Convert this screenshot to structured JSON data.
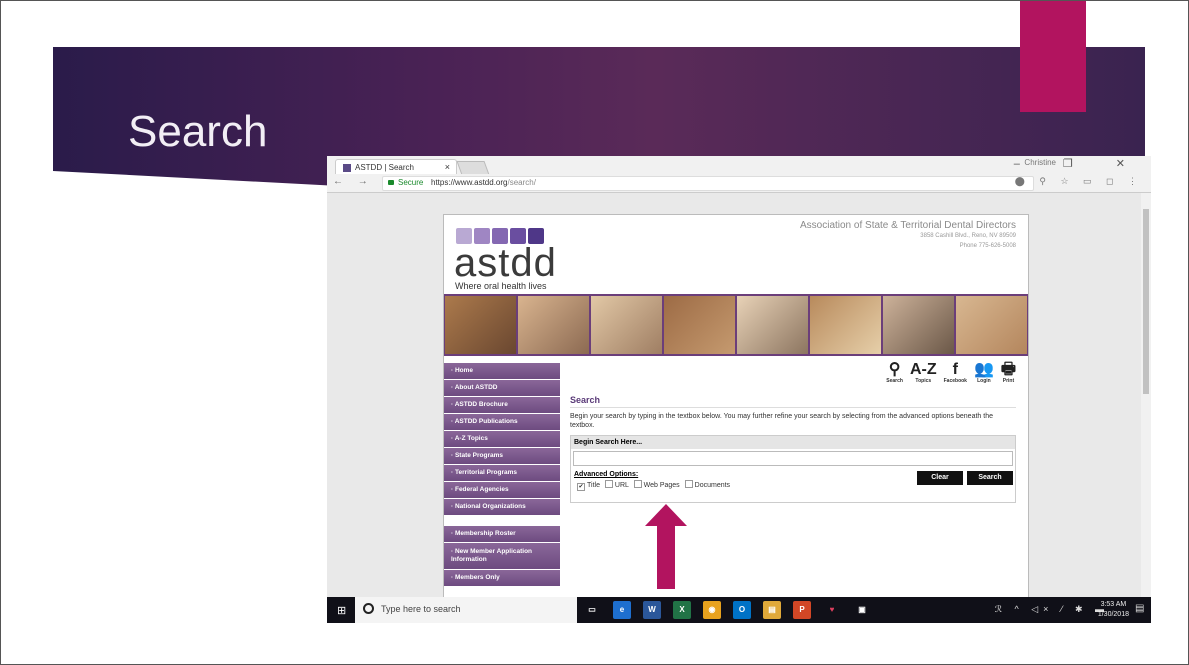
{
  "slide": {
    "title": "Search",
    "accent_color": "#b2145f"
  },
  "browser": {
    "tab_title": "ASTDD | Search",
    "tab_close": "×",
    "user_name": "Christine",
    "window_controls": "– ❐ ✕",
    "nav_buttons": "← → C",
    "secure_label": "Secure",
    "url_host": "https://www.astdd.org",
    "url_path": "/search/",
    "ext_icons": "⬤ ⚲ ☆ ▭ ◻ ⋮"
  },
  "site": {
    "org_name": "Association of State & Territorial Dental Directors",
    "org_address": "3858 Cashill Blvd., Reno, NV 89509",
    "org_phone": "Phone 775-626-5008",
    "logo_text": "astdd",
    "logo_tagline": "Where oral health lives",
    "logo_colors": [
      "#b9a9d3",
      "#9f86c3",
      "#8468b2",
      "#6a4ea0",
      "#4f3788"
    ],
    "nav_items": [
      "· Home",
      "· About ASTDD",
      "· ASTDD Brochure",
      "· ASTDD Publications",
      "· A-Z Topics",
      "· State Programs",
      "· Territorial Programs",
      "· Federal Agencies",
      "· National Organizations"
    ],
    "nav_items_2": [
      "· Membership Roster",
      "· New Member Application Information",
      "· Members Only"
    ],
    "icons": [
      {
        "glyph": "⚲",
        "label": "Search",
        "icon": "search-icon"
      },
      {
        "glyph": "A-Z",
        "label": "Topics",
        "icon": "az-topics-icon"
      },
      {
        "glyph": "f",
        "label": "Facebook",
        "icon": "facebook-icon"
      },
      {
        "glyph": "👥",
        "label": "Login",
        "icon": "login-icon"
      },
      {
        "glyph": "🖶",
        "label": "Print",
        "icon": "print-icon"
      }
    ]
  },
  "search": {
    "title": "Search",
    "description": "Begin your search by typing in the textbox below. You may further refine your search by selecting from the advanced options beneath the textbox.",
    "box_header": "Begin Search Here...",
    "input_value": "",
    "advanced_label": "Advanced Options:",
    "options": [
      {
        "label": "Title",
        "checked": true
      },
      {
        "label": "URL",
        "checked": false
      },
      {
        "label": "Web Pages",
        "checked": false
      },
      {
        "label": "Documents",
        "checked": false
      }
    ],
    "clear_label": "Clear",
    "search_label": "Search"
  },
  "taskbar": {
    "search_placeholder": "Type here to search",
    "time": "3:53 AM",
    "date": "1/30/2018",
    "tray_icons": "ℛ ^ ◁× ⁄ ✱ ▬",
    "apps": [
      {
        "label": "▭",
        "color": "#101018",
        "icon": "task-view-icon"
      },
      {
        "label": "e",
        "color": "#1e6fcf",
        "icon": "edge-icon"
      },
      {
        "label": "W",
        "color": "#2b579a",
        "icon": "word-icon"
      },
      {
        "label": "X",
        "color": "#217346",
        "icon": "excel-icon"
      },
      {
        "label": "◉",
        "color": "#e8a21e",
        "icon": "chrome-icon"
      },
      {
        "label": "O",
        "color": "#0072c6",
        "icon": "outlook-icon"
      },
      {
        "label": "▤",
        "color": "#e0a93a",
        "icon": "file-explorer-icon"
      },
      {
        "label": "P",
        "color": "#d24726",
        "icon": "powerpoint-icon"
      },
      {
        "label": "♥",
        "color": "#101018",
        "icon": "maps-icon"
      },
      {
        "label": "▣",
        "color": "#101018",
        "icon": "photos-icon"
      }
    ]
  }
}
